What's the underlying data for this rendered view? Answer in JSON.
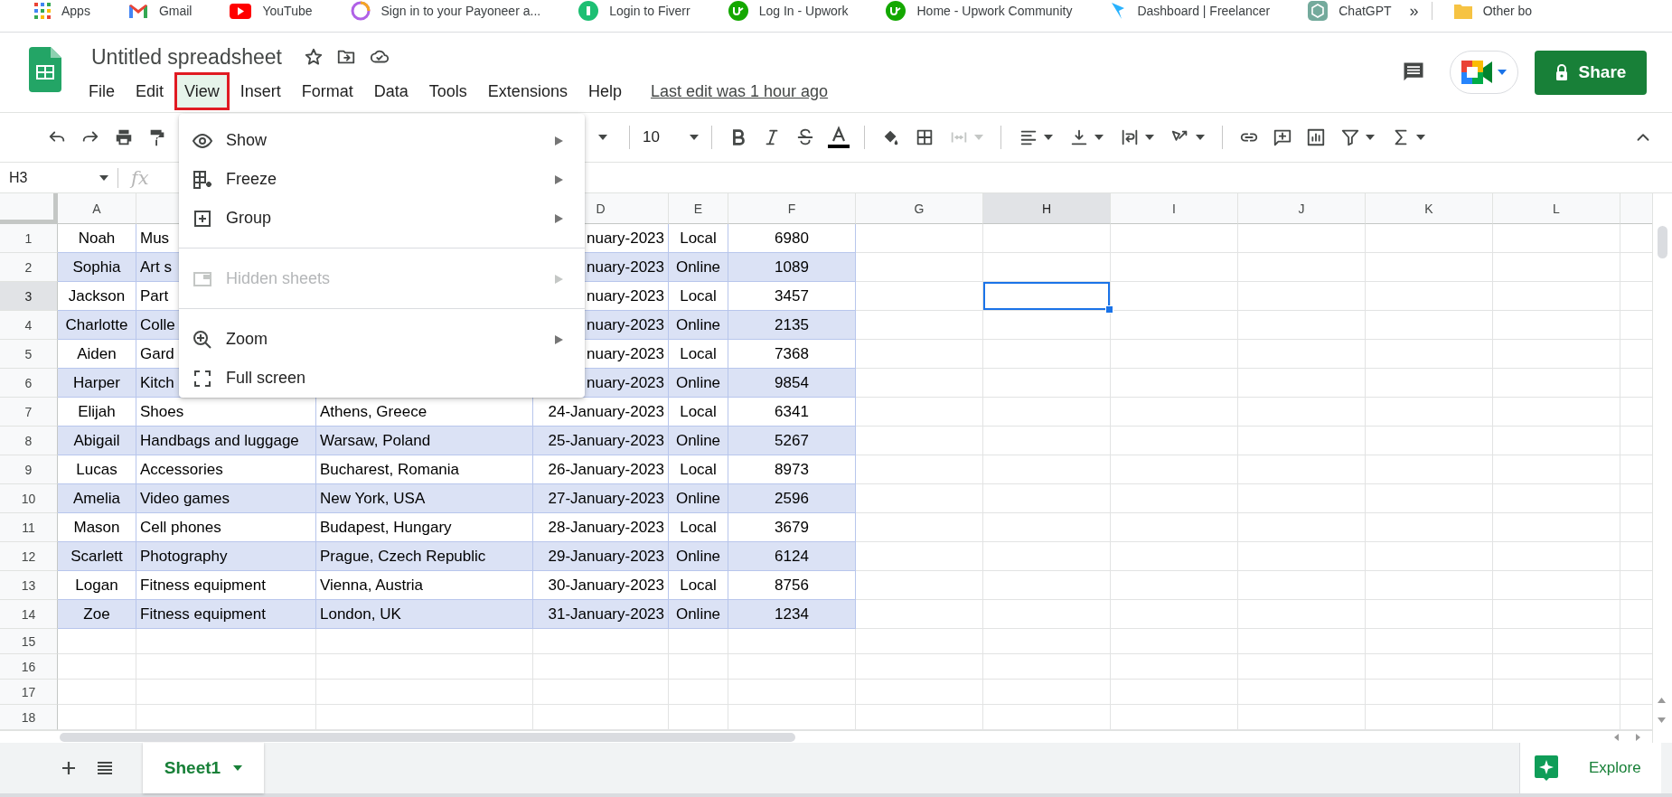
{
  "bookmarks": [
    {
      "label": "Apps"
    },
    {
      "label": "Gmail"
    },
    {
      "label": "YouTube"
    },
    {
      "label": "Sign in to your Payoneer a..."
    },
    {
      "label": "Login to Fiverr"
    },
    {
      "label": "Log In - Upwork"
    },
    {
      "label": "Home - Upwork Community"
    },
    {
      "label": "Dashboard | Freelancer"
    },
    {
      "label": "ChatGPT"
    },
    {
      "label": "»"
    },
    {
      "label": "Other bo"
    }
  ],
  "document": {
    "title": "Untitled spreadsheet",
    "last_edit": "Last edit was 1 hour ago"
  },
  "menus": [
    {
      "label": "File",
      "selected": false
    },
    {
      "label": "Edit",
      "selected": false
    },
    {
      "label": "View",
      "selected": true
    },
    {
      "label": "Insert",
      "selected": false
    },
    {
      "label": "Format",
      "selected": false
    },
    {
      "label": "Data",
      "selected": false
    },
    {
      "label": "Tools",
      "selected": false
    },
    {
      "label": "Extensions",
      "selected": false
    },
    {
      "label": "Help",
      "selected": false
    }
  ],
  "share_button": "Share",
  "toolbar": {
    "font_size": "10",
    "merge_cells": {
      "disabled": true
    }
  },
  "formula_bar": {
    "name_box": "H3",
    "fx": "fx"
  },
  "columns": [
    {
      "header": "A",
      "selected": false
    },
    {},
    {},
    {
      "header": "D",
      "selected": false
    },
    {
      "header": "E",
      "selected": false
    },
    {
      "header": "F",
      "selected": false
    },
    {
      "header": "G",
      "selected": false
    },
    {
      "header": "H",
      "selected": true
    },
    {
      "header": "I",
      "selected": false
    },
    {
      "header": "J",
      "selected": false
    },
    {
      "header": "K",
      "selected": false
    },
    {
      "header": "L",
      "selected": false
    }
  ],
  "rows": [
    {
      "number": "1",
      "selected": false,
      "shaded": false,
      "cells": {
        "A": "Noah",
        "B": "Mus",
        "D": "nuary-2023",
        "E": "Local",
        "F": "6980"
      }
    },
    {
      "number": "2",
      "selected": false,
      "shaded": true,
      "cells": {
        "A": "Sophia",
        "B": "Art s",
        "D": "nuary-2023",
        "E": "Online",
        "F": "1089"
      }
    },
    {
      "number": "3",
      "selected": true,
      "shaded": false,
      "cells": {
        "A": "Jackson",
        "B": "Part",
        "D": "nuary-2023",
        "E": "Local",
        "F": "3457"
      }
    },
    {
      "number": "4",
      "selected": false,
      "shaded": true,
      "cells": {
        "A": "Charlotte",
        "B": "Colle",
        "D": "nuary-2023",
        "E": "Online",
        "F": "2135"
      }
    },
    {
      "number": "5",
      "selected": false,
      "shaded": false,
      "cells": {
        "A": "Aiden",
        "B": "Gard",
        "D": "nuary-2023",
        "E": "Local",
        "F": "7368"
      }
    },
    {
      "number": "6",
      "selected": false,
      "shaded": true,
      "cells": {
        "A": "Harper",
        "B": "Kitch",
        "D": "nuary-2023",
        "E": "Online",
        "F": "9854"
      }
    },
    {
      "number": "7",
      "selected": false,
      "shaded": false,
      "cells": {
        "A": "Elijah",
        "B": "Shoes",
        "C": "Athens, Greece",
        "D": "24-January-2023",
        "E": "Local",
        "F": "6341"
      }
    },
    {
      "number": "8",
      "selected": false,
      "shaded": true,
      "cells": {
        "A": "Abigail",
        "B": "Handbags and luggage",
        "C": "Warsaw, Poland",
        "D": "25-January-2023",
        "E": "Online",
        "F": "5267"
      }
    },
    {
      "number": "9",
      "selected": false,
      "shaded": false,
      "cells": {
        "A": "Lucas",
        "B": "Accessories",
        "C": "Bucharest, Romania",
        "D": "26-January-2023",
        "E": "Local",
        "F": "8973"
      }
    },
    {
      "number": "10",
      "selected": false,
      "shaded": true,
      "cells": {
        "A": "Amelia",
        "B": "Video games",
        "C": "New York, USA",
        "D": "27-January-2023",
        "E": "Online",
        "F": "2596"
      }
    },
    {
      "number": "11",
      "selected": false,
      "shaded": false,
      "cells": {
        "A": "Mason",
        "B": "Cell phones",
        "C": "Budapest, Hungary",
        "D": "28-January-2023",
        "E": "Local",
        "F": "3679"
      }
    },
    {
      "number": "12",
      "selected": false,
      "shaded": true,
      "cells": {
        "A": "Scarlett",
        "B": "Photography",
        "C": "Prague, Czech Republic",
        "D": "29-January-2023",
        "E": "Online",
        "F": "6124"
      }
    },
    {
      "number": "13",
      "selected": false,
      "shaded": false,
      "cells": {
        "A": "Logan",
        "B": "Fitness equipment",
        "C": "Vienna, Austria",
        "D": "30-January-2023",
        "E": "Local",
        "F": "8756"
      }
    },
    {
      "number": "14",
      "selected": false,
      "shaded": true,
      "cells": {
        "A": "Zoe",
        "B": "Fitness equipment",
        "C": "London, UK",
        "D": "31-January-2023",
        "E": "Online",
        "F": "1234"
      }
    },
    {
      "number": "15",
      "selected": false
    },
    {
      "number": "16",
      "selected": false
    },
    {
      "number": "17",
      "selected": false
    },
    {
      "number": "18",
      "selected": false
    }
  ],
  "view_menu": {
    "items": [
      {
        "kind": "item",
        "label": "Show",
        "submenu": true,
        "disabled": false
      },
      {
        "kind": "item",
        "label": "Freeze",
        "submenu": true,
        "disabled": false
      },
      {
        "kind": "item",
        "label": "Group",
        "submenu": true,
        "disabled": false
      },
      {
        "kind": "divider"
      },
      {
        "kind": "item",
        "label": "Hidden sheets",
        "submenu": true,
        "disabled": true
      },
      {
        "kind": "divider"
      },
      {
        "kind": "item",
        "label": "Zoom",
        "submenu": true,
        "disabled": false
      },
      {
        "kind": "item",
        "label": "Full screen",
        "submenu": false,
        "disabled": false
      }
    ]
  },
  "sheet_tabs": [
    {
      "label": "Sheet1",
      "selected": true
    }
  ],
  "explore_button": "Explore"
}
